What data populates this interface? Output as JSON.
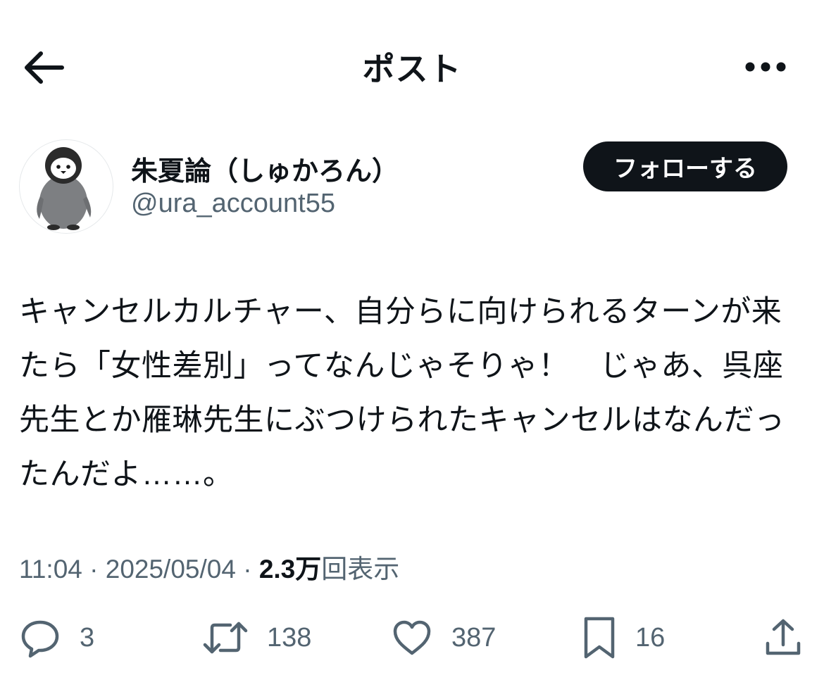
{
  "header": {
    "title": "ポスト",
    "back_icon": "arrow-left-icon",
    "more_icon": "more-horizontal-icon"
  },
  "author": {
    "display_name": "朱夏論（しゅかろん）",
    "handle": "@ura_account55",
    "avatar_icon": "penguin-avatar",
    "follow_label": "フォローする"
  },
  "post": {
    "text": "キャンセルカルチャー、自分らに向けられるターンが来たら「女性差別」ってなんじゃそりゃ！　じゃあ、呉座先生とか雁琳先生にぶつけられたキャンセルはなんだったんだよ……。"
  },
  "meta": {
    "time": "11:04",
    "separator": " · ",
    "date": "2025/05/04",
    "views_count": "2.3万",
    "views_label": "回表示"
  },
  "actions": {
    "reply": {
      "icon": "reply-icon",
      "count": "3"
    },
    "repost": {
      "icon": "repost-icon",
      "count": "138"
    },
    "like": {
      "icon": "heart-icon",
      "count": "387"
    },
    "bookmark": {
      "icon": "bookmark-icon",
      "count": "16"
    },
    "share": {
      "icon": "share-icon"
    }
  },
  "colors": {
    "text": "#0f1419",
    "secondary": "#536471",
    "button_bg": "#0f1419",
    "button_text": "#ffffff"
  }
}
